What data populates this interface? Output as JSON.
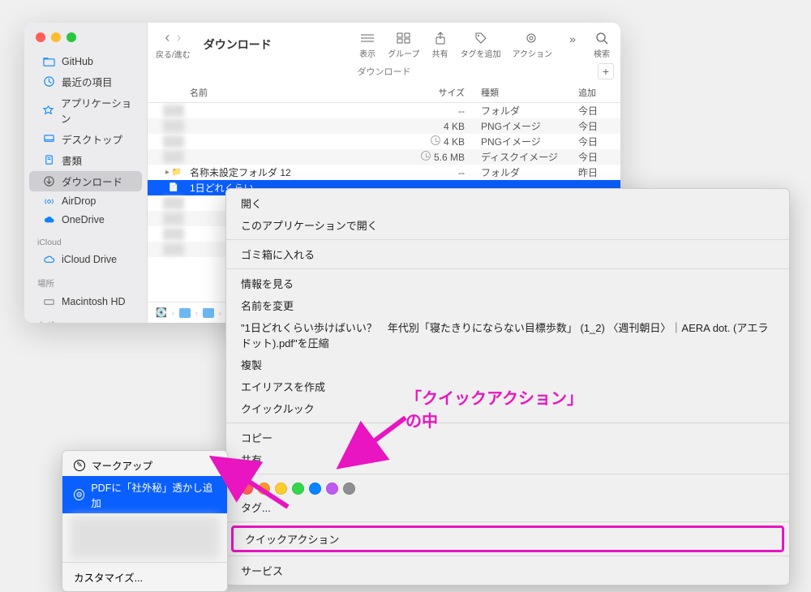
{
  "window": {
    "title": "ダウンロード",
    "subtitle": "ダウンロード"
  },
  "toolbar": {
    "back_fwd": "戻る/進む",
    "view": "表示",
    "group": "グループ",
    "share": "共有",
    "tags": "タグを追加",
    "action": "アクション",
    "more": ">>",
    "search": "検索"
  },
  "sidebar": {
    "items": [
      {
        "label": "GitHub",
        "icon": "github"
      },
      {
        "label": "最近の項目",
        "icon": "clock"
      },
      {
        "label": "アプリケーション",
        "icon": "apps"
      },
      {
        "label": "デスクトップ",
        "icon": "desktop"
      },
      {
        "label": "書類",
        "icon": "docs"
      },
      {
        "label": "ダウンロード",
        "icon": "download",
        "selected": true
      },
      {
        "label": "AirDrop",
        "icon": "airdrop"
      },
      {
        "label": "OneDrive",
        "icon": "onedrive"
      }
    ],
    "sections": {
      "icloud": "iCloud",
      "locations": "場所",
      "tags": "タグ"
    },
    "icloud_item": "iCloud Drive",
    "location_item": "Macintosh HD"
  },
  "columns": {
    "name": "名前",
    "size": "サイズ",
    "kind": "種類",
    "date": "追加"
  },
  "rows": [
    {
      "name": "",
      "size": "--",
      "kind": "フォルダ",
      "date": "今日"
    },
    {
      "name": "",
      "size": "4 KB",
      "kind": "PNGイメージ",
      "date": "今日"
    },
    {
      "name": "",
      "size": "4 KB",
      "kind": "PNGイメージ",
      "date": "今日",
      "pending": true
    },
    {
      "name": "",
      "size": "5.6 MB",
      "kind": "ディスクイメージ",
      "date": "今日",
      "pending": true
    },
    {
      "name": "名称未設定フォルダ 12",
      "size": "--",
      "kind": "フォルダ",
      "date": "昨日"
    },
    {
      "name": "1日どれくらい...",
      "size": "",
      "kind": "",
      "date": "",
      "selected": true
    }
  ],
  "context": {
    "open": "開く",
    "open_with": "このアプリケーションで開く",
    "trash": "ゴミ箱に入れる",
    "info": "情報を見る",
    "rename": "名前を変更",
    "compress": "\"1日どれくらい歩けばいい？　年代別「寝たきりにならない目標歩数」 (1_2) 〈週刊朝日〉｜AERA dot. (アエラドット).pdf\"を圧縮",
    "duplicate": "複製",
    "alias": "エイリアスを作成",
    "quicklook": "クイックルック",
    "copy": "コピー",
    "share": "共有",
    "tags_label": "タグ...",
    "quick_actions": "クイックアクション",
    "services": "サービス",
    "tag_colors": [
      "#ff5f57",
      "#fd9a26",
      "#fdcd2e",
      "#32d74b",
      "#0a84ff",
      "#bf5af2",
      "#8e8e93"
    ]
  },
  "submenu": {
    "markup": "マークアップ",
    "watermark": "PDFに「社外秘」透かし追加",
    "customize": "カスタマイズ..."
  },
  "annotation": {
    "line1": "「クイックアクション」",
    "line2": "の中"
  }
}
